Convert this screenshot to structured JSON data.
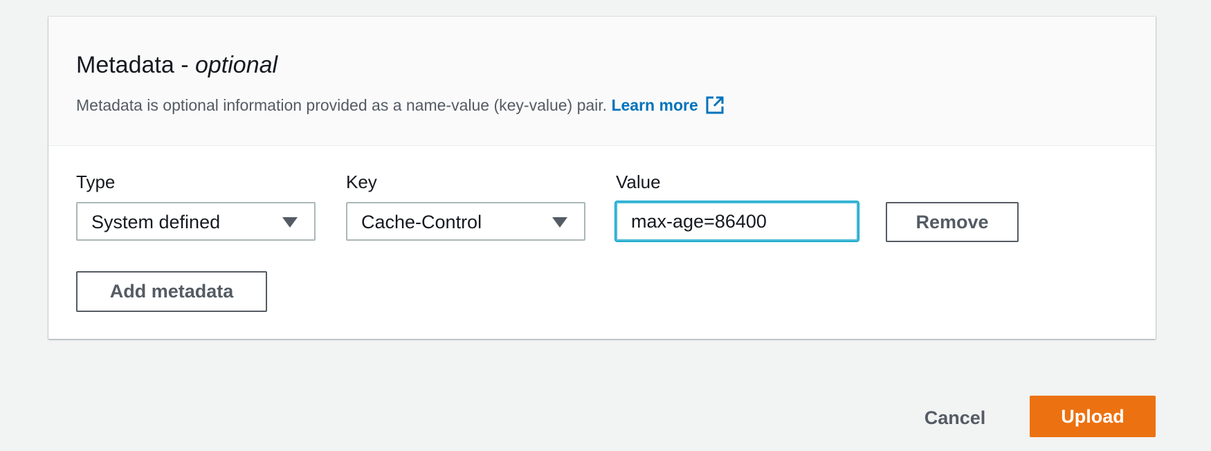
{
  "metadata_panel": {
    "title_main": "Metadata - ",
    "title_optional": "optional",
    "description": "Metadata is optional information provided as a name-value (key-value) pair. ",
    "learn_more": "Learn more",
    "learn_more_icon": "external-link-icon"
  },
  "fields": {
    "type_label": "Type",
    "type_value": "System defined",
    "key_label": "Key",
    "key_value": "Cache-Control",
    "value_label": "Value",
    "value_value": "max-age=86400",
    "dropdown_icon": "caret-down-icon"
  },
  "buttons": {
    "remove": "Remove",
    "add_metadata": "Add metadata",
    "cancel": "Cancel",
    "upload": "Upload"
  },
  "colors": {
    "link": "#0073bb",
    "primary": "#ec7211",
    "focus_border": "#44b9d6",
    "background": "#f2f3f3"
  }
}
